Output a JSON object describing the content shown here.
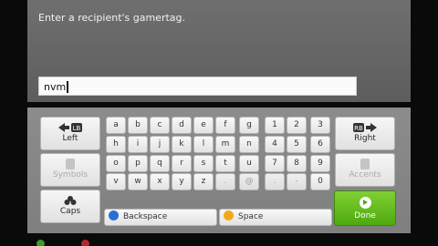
{
  "header": {
    "prompt": "Enter a recipient's gamertag."
  },
  "input": {
    "value": "nvm"
  },
  "left_keys": {
    "left": "Left",
    "symbols": "Symbols",
    "caps": "Caps"
  },
  "right_keys": {
    "right": "Right",
    "accents": "Accents",
    "done": "Done"
  },
  "keys": [
    [
      "a",
      "b",
      "c",
      "d",
      "e",
      "f",
      "g",
      "1",
      "2",
      "3"
    ],
    [
      "h",
      "i",
      "j",
      "k",
      "l",
      "m",
      "n",
      "4",
      "5",
      "6"
    ],
    [
      "o",
      "p",
      "q",
      "r",
      "s",
      "t",
      "u",
      "7",
      "8",
      "9"
    ],
    [
      "v",
      "w",
      "x",
      "y",
      "z",
      ".",
      "@",
      ".",
      "-",
      "0"
    ]
  ],
  "dim_keys": [
    ".",
    "@",
    ".",
    "-"
  ],
  "bottom_bar": {
    "backspace": {
      "label": "Backspace",
      "button": "X",
      "color": "#2b6fd6"
    },
    "space": {
      "label": "Space",
      "button": "Y",
      "color": "#f1a91c"
    }
  },
  "bumpers": {
    "left": "LB",
    "right": "RB"
  },
  "colors": {
    "done_green": "#5db91b",
    "x_blue": "#2b6fd6",
    "y_yellow": "#f1a91c"
  }
}
